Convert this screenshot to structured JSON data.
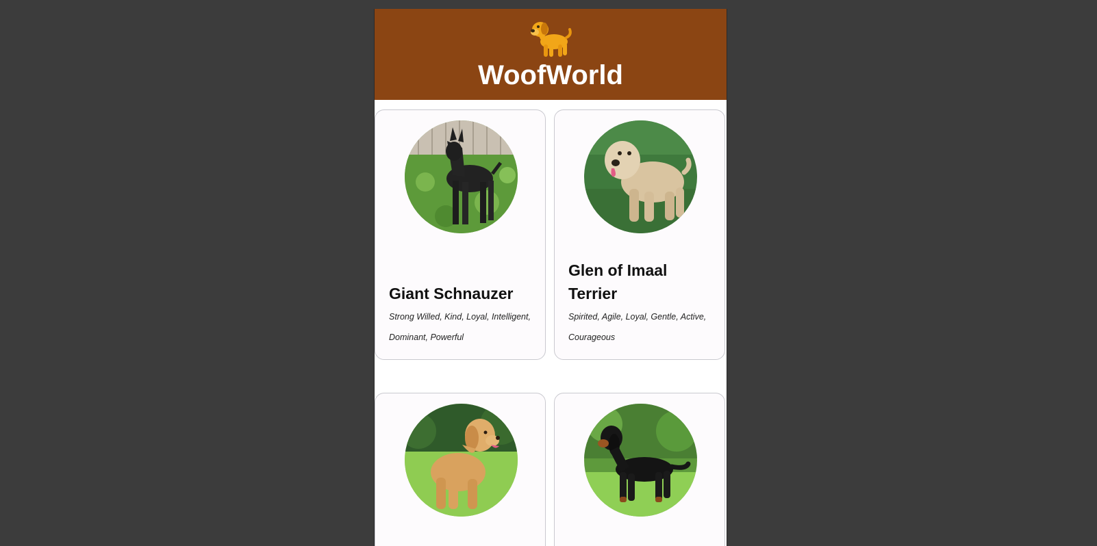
{
  "site": {
    "title": "WoofWorld",
    "logo_icon": "dog-icon"
  },
  "breeds": [
    {
      "name": "Giant Schnauzer",
      "traits": "Strong Willed, Kind, Loyal, Intelligent, Dominant, Powerful",
      "photo": "black-giant-schnauzer-photo"
    },
    {
      "name": "Glen of Imaal Terrier",
      "traits": "Spirited, Agile, Loyal, Gentle, Active, Courageous",
      "photo": "wheaten-terrier-photo"
    },
    {
      "name": "",
      "traits": "",
      "photo": "golden-retriever-photo"
    },
    {
      "name": "",
      "traits": "",
      "photo": "gordon-setter-photo"
    }
  ],
  "colors": {
    "header": "#8b4513",
    "card_bg": "#fdfbfd",
    "page_bg": "#3c3c3c"
  }
}
